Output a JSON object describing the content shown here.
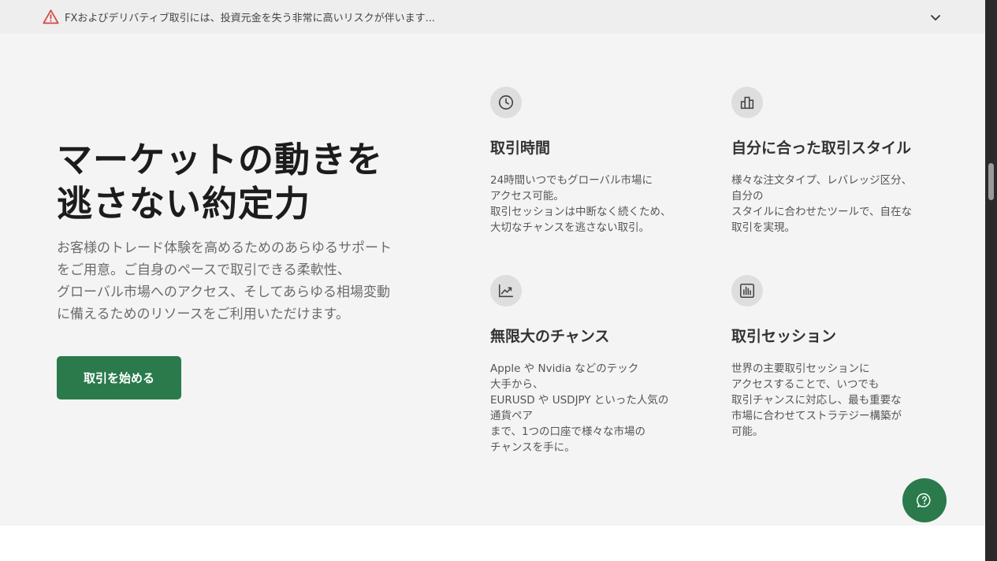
{
  "risk_banner": {
    "text": "FXおよびデリバティブ取引には、投資元金を失う非常に高いリスクが伴います..."
  },
  "hero": {
    "title_lines": [
      "マーケットの動きを",
      "逃さない約定力"
    ],
    "description_lines": [
      "お客様のトレード体験を高めるためのあらゆるサポート",
      "をご用意。ご自身のペースで取引できる柔軟性、",
      "グローバル市場へのアクセス、そしてあらゆる相場変動",
      "に備えるためのリソースをご利用いただけます。"
    ],
    "cta_label": "取引を始める"
  },
  "features": [
    {
      "icon": "clock-icon",
      "title": "取引時間",
      "desc_lines": [
        "24時間いつでもグローバル市場に",
        "アクセス可能。",
        "取引セッションは中断なく続くため、",
        "大切なチャンスを逃さない取引。"
      ]
    },
    {
      "icon": "bar-chart-icon",
      "title": "自分に合った取引スタイル",
      "desc_lines": [
        "様々な注文タイプ、レバレッジ区分、",
        "自分の",
        "スタイルに合わせたツールで、自在な",
        "取引を実現。"
      ]
    },
    {
      "icon": "trend-up-icon",
      "title": "無限大のチャンス",
      "desc_lines": [
        "Apple や Nvidia などのテック",
        "大手から、",
        "EURUSD や USDJPY といった人気の",
        "通貨ペア",
        "まで、1つの口座で様々な市場の",
        "チャンスを手に。"
      ]
    },
    {
      "icon": "column-chart-icon",
      "title": "取引セッション",
      "desc_lines": [
        "世界の主要取引セッションに",
        "アクセスすることで、いつでも",
        "取引チャンスに対応し、最も重要な",
        "市場に合わせてストラテジー構築が",
        "可能。"
      ]
    }
  ],
  "colors": {
    "brand_green": "#2a7a4b",
    "warning_red": "#d64545",
    "hero_bg": "#f4f4f4"
  }
}
